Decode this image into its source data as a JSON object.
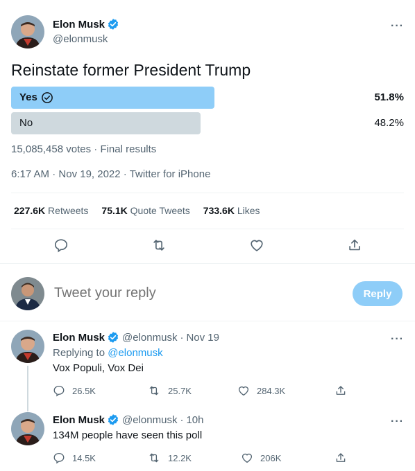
{
  "tweet": {
    "author_name": "Elon Musk",
    "author_handle": "@elonmusk",
    "text": "Reinstate former President Trump",
    "poll": {
      "options": [
        {
          "label": "Yes",
          "percent": "51.8%",
          "fraction": 0.518,
          "winner": true
        },
        {
          "label": "No",
          "percent": "48.2%",
          "fraction": 0.482,
          "winner": false
        }
      ],
      "votes": "15,085,458 votes",
      "status": "Final results"
    },
    "time": "6:17 AM",
    "date": "Nov 19, 2022",
    "source": "Twitter for iPhone",
    "stats": {
      "retweets_count": "227.6K",
      "retweets_label": "Retweets",
      "quotes_count": "75.1K",
      "quotes_label": "Quote Tweets",
      "likes_count": "733.6K",
      "likes_label": "Likes"
    },
    "icons": [
      "reply-icon",
      "retweet-icon",
      "like-icon",
      "share-icon"
    ]
  },
  "reply_box": {
    "placeholder": "Tweet your reply",
    "button_label": "Reply"
  },
  "replies": [
    {
      "name": "Elon Musk",
      "handle": "@elonmusk",
      "time": "Nov 19",
      "replying_prefix": "Replying to",
      "replying_to": "@elonmusk",
      "text": "Vox Populi, Vox Dei",
      "replies_count": "26.5K",
      "retweets_count": "25.7K",
      "likes_count": "284.3K"
    },
    {
      "name": "Elon Musk",
      "handle": "@elonmusk",
      "time": "10h",
      "text": "134M people have seen this poll",
      "replies_count": "14.5K",
      "retweets_count": "12.2K",
      "likes_count": "206K"
    }
  ],
  "separator": "·",
  "more_label": "···",
  "colors": {
    "accent": "#1d9bf0",
    "poll_winner": "#8ecdf8",
    "poll_other": "#cfd9de",
    "secondary_text": "#536471"
  }
}
